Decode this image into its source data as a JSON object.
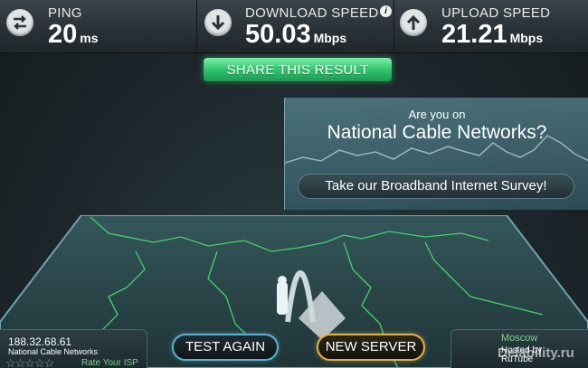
{
  "header": {
    "ping": {
      "title": "PING",
      "value": "20",
      "unit": "ms",
      "icon": "ping-icon"
    },
    "download": {
      "title": "DOWNLOAD SPEED",
      "value": "50.03",
      "unit": "Mbps",
      "icon": "download-arrow-icon",
      "info": "i"
    },
    "upload": {
      "title": "UPLOAD SPEED",
      "value": "21.21",
      "unit": "Mbps",
      "icon": "upload-arrow-icon"
    }
  },
  "share_label": "SHARE THIS RESULT",
  "survey": {
    "question_line1": "Are you on",
    "question_line2": "National Cable Networks?",
    "button_label": "Take our Broadband Internet Survey!"
  },
  "client": {
    "ip": "188.32.68.61",
    "isp": "National Cable Networks",
    "stars": "☆☆☆☆☆",
    "rating_label": "Rate Your ISP"
  },
  "buttons": {
    "test_again": "TEST AGAIN",
    "new_server": "NEW SERVER"
  },
  "server": {
    "city": "Moscow",
    "host_line1": "Hosted by",
    "host_line2": "RuTube"
  },
  "watermark": "Delability.ru",
  "colors": {
    "accent_green": "#31c56e",
    "test_again_border": "#5ab3cf",
    "new_server_border": "#e0b34a",
    "map_lines": "#3fd56a"
  }
}
